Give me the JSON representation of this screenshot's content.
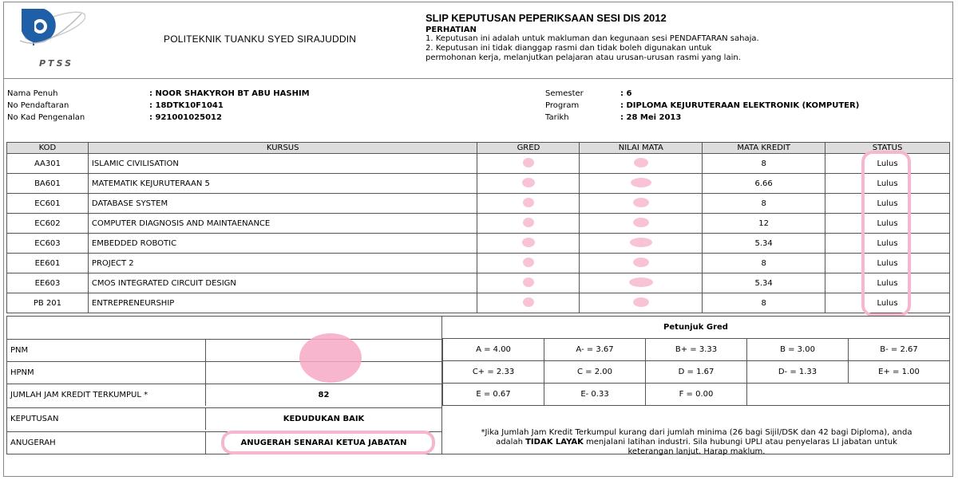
{
  "header": {
    "logo_text": "PTSS",
    "school_name": "POLITEKNIK TUANKU SYED SIRAJUDDIN",
    "slip_title": "SLIP KEPUTUSAN PEPERIKSAAN SESI DIS 2012",
    "perhatian_label": "PERHATIAN",
    "note_1": "1. Keputusan ini adalah untuk makluman dan kegunaan sesi PENDAFTARAN sahaja.",
    "note_2a": "2. Keputusan ini tidak dianggap rasmi dan tidak boleh digunakan untuk",
    "note_2b": "permohonan kerja, melanjutkan pelajaran atau urusan-urusan rasmi yang lain."
  },
  "student": {
    "name_label": "Nama Penuh",
    "name": ": NOOR SHAKYROH BT ABU HASHIM",
    "reg_label": "No Pendaftaran",
    "reg": ": 18DTK10F1041",
    "ic_label": "No Kad Pengenalan",
    "ic": ": 921001025012",
    "semester_label": "Semester",
    "semester": ": 6",
    "program_label": "Program",
    "program": ": DIPLOMA KEJURUTERAAN ELEKTRONIK (KOMPUTER)",
    "date_label": "Tarikh",
    "date": ": 28 Mei 2013"
  },
  "courses": {
    "headers": [
      "KOD",
      "KURSUS",
      "GRED",
      "NILAI MATA",
      "MATA KREDIT",
      "STATUS"
    ],
    "rows": [
      {
        "kod": "AA301",
        "kursus": "ISLAMIC CIVILISATION",
        "kredit": "8",
        "status": "Lulus"
      },
      {
        "kod": "BA601",
        "kursus": "MATEMATIK KEJURUTERAAN 5",
        "kredit": "6.66",
        "status": "Lulus"
      },
      {
        "kod": "EC601",
        "kursus": "DATABASE SYSTEM",
        "kredit": "8",
        "status": "Lulus"
      },
      {
        "kod": "EC602",
        "kursus": "COMPUTER DIAGNOSIS AND MAINTAENANCE",
        "kredit": "12",
        "status": "Lulus"
      },
      {
        "kod": "EC603",
        "kursus": "EMBEDDED ROBOTIC",
        "kredit": "5.34",
        "status": "Lulus"
      },
      {
        "kod": "EE601",
        "kursus": "PROJECT 2",
        "kredit": "8",
        "status": "Lulus"
      },
      {
        "kod": "EE603",
        "kursus": "CMOS INTEGRATED CIRCUIT DESIGN",
        "kredit": "5.34",
        "status": "Lulus"
      },
      {
        "kod": "PB 201",
        "kursus": "ENTREPRENEURSHIP",
        "kredit": "8",
        "status": "Lulus"
      }
    ]
  },
  "summary": {
    "pnm_label": "PNM",
    "hpnm_label": "HPNM",
    "credit_label": "JUMLAH JAM KREDIT TERKUMPUL *",
    "credit_value": "82",
    "keputusan_label": "KEPUTUSAN",
    "keputusan_value": "KEDUDUKAN BAIK",
    "anugerah_label": "ANUGERAH",
    "anugerah_value": "ANUGERAH SENARAI KETUA JABATAN"
  },
  "grade_guide": {
    "title": "Petunjuk Gred",
    "rows": [
      [
        "A = 4.00",
        "A- = 3.67",
        "B+ = 3.33",
        "B = 3.00",
        "B- = 2.67"
      ],
      [
        "C+ = 2.33",
        "C = 2.00",
        "D = 1.67",
        "D- = 1.33",
        "E+ = 1.00"
      ],
      [
        "E = 0.67",
        "E- 0.33",
        "F = 0.00",
        "",
        ""
      ]
    ]
  },
  "footnote": {
    "line1": "*Jika Jumlah Jam Kredit Terkumpul kurang dari jumlah minima (26 bagi Sijil/DSK dan 42 bagi Diploma), anda",
    "line2a": "adalah ",
    "line2b": "TIDAK LAYAK",
    "line2c": " menjalani latihan industri. Sila hubungi UPLI atau penyelaras LI jabatan untuk",
    "line3": "keterangan lanjut. Harap maklum."
  },
  "colors": {
    "highlight": "#f6b6cf",
    "header_bg": "#dddddd"
  }
}
